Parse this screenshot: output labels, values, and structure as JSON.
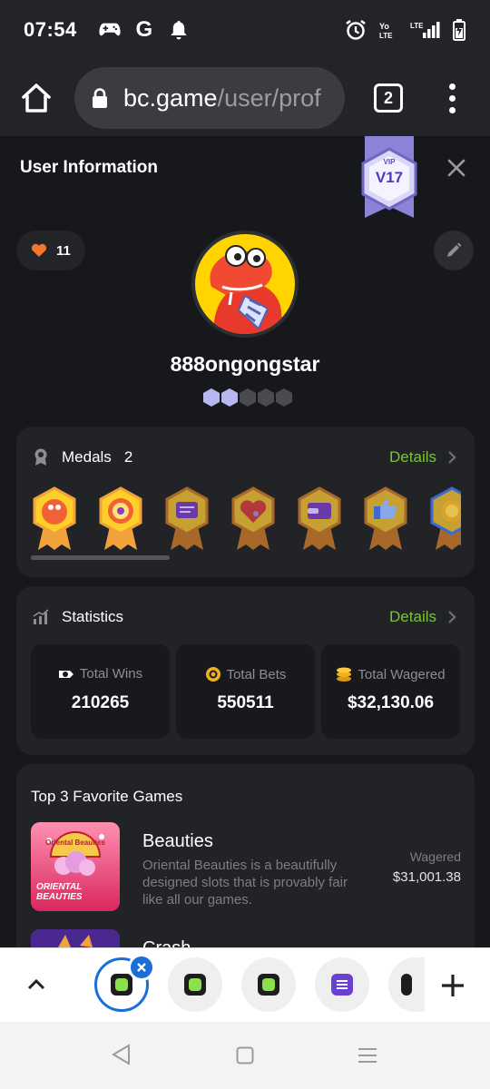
{
  "status_bar": {
    "time": "07:54",
    "left_icons": [
      "gamepad-icon",
      "google-icon",
      "bell-icon"
    ],
    "google_glyph": "G",
    "right_icons": [
      "alarm-icon",
      "volte-icon",
      "lte-signal-icon",
      "battery-icon"
    ],
    "volte_text": "Yo LTE",
    "lte_text": "LTE"
  },
  "browser": {
    "url_host": "bc.game",
    "url_path": "/user/prof",
    "tab_count": "2"
  },
  "profile": {
    "title": "User Information",
    "vip_small": "VIP",
    "vip_level": "V17",
    "likes": "11",
    "username": "888ongongstar",
    "level_dots_filled": 2,
    "level_dots_total": 5
  },
  "medals": {
    "title": "Medals",
    "count": "2",
    "details_label": "Details",
    "items": [
      {
        "icon": "dino-medal-icon",
        "earned": true
      },
      {
        "icon": "wheel-medal-icon",
        "earned": true
      },
      {
        "icon": "chat-medal-icon",
        "earned": false
      },
      {
        "icon": "heart-medal-icon",
        "earned": false
      },
      {
        "icon": "wallet-medal-icon",
        "earned": false
      },
      {
        "icon": "thumbs-up-medal-icon",
        "earned": false
      },
      {
        "icon": "coin-medal-icon",
        "earned": false
      }
    ]
  },
  "statistics": {
    "title": "Statistics",
    "details_label": "Details",
    "items": [
      {
        "label": "Total Wins",
        "value": "210265",
        "icon": "wins-icon"
      },
      {
        "label": "Total Bets",
        "value": "550511",
        "icon": "bets-icon"
      },
      {
        "label": "Total Wagered",
        "value": "$32,130.06",
        "icon": "wagered-icon"
      }
    ]
  },
  "favorites": {
    "title": "Top 3 Favorite Games",
    "games": [
      {
        "name": "Beauties",
        "description": "Oriental Beauties is a beautifully designed slots that is provably fair like all our games.",
        "wagered_label": "Wagered",
        "wagered_value": "$31,001.38",
        "thumb_label_top": "Oriental Beauties",
        "thumb_label_bottom": "ORIENTAL BEAUTIES"
      },
      {
        "name": "Crash"
      }
    ]
  },
  "colors": {
    "accent_green": "#7bc33b",
    "background": "#17181b",
    "card": "#222327",
    "vip": "#8b84d6",
    "tab_active": "#1a6ed8"
  }
}
